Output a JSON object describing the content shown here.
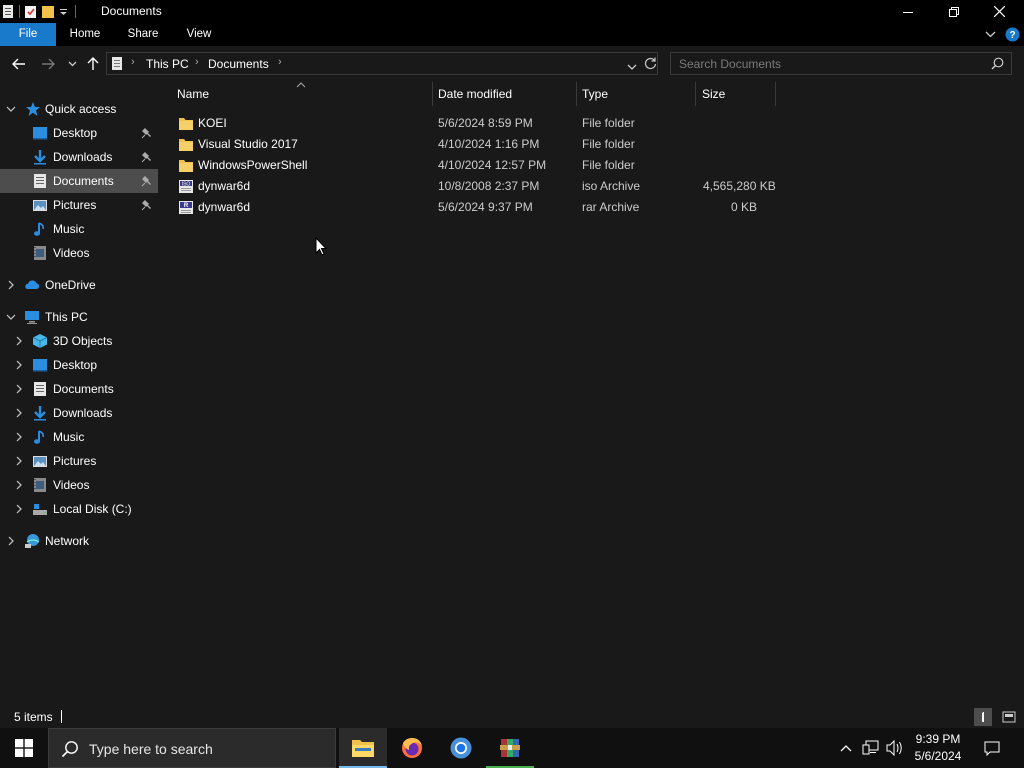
{
  "window": {
    "title": "Documents",
    "icons": [
      "properties-icon",
      "new-folder-icon",
      "folder-icon",
      "customize-dropdown-icon"
    ]
  },
  "ribbon": {
    "tabs": [
      {
        "label": "File"
      },
      {
        "label": "Home"
      },
      {
        "label": "Share"
      },
      {
        "label": "View"
      }
    ]
  },
  "address": {
    "crumbs": [
      "This PC",
      "Documents"
    ]
  },
  "search": {
    "placeholder": "Search Documents"
  },
  "nav": {
    "quick_access": "Quick access",
    "quick_items": [
      {
        "label": "Desktop",
        "icon": "desktop-icon",
        "pinned": true
      },
      {
        "label": "Downloads",
        "icon": "downloads-icon",
        "pinned": true
      },
      {
        "label": "Documents",
        "icon": "documents-icon",
        "pinned": true,
        "selected": true
      },
      {
        "label": "Pictures",
        "icon": "pictures-icon",
        "pinned": true
      },
      {
        "label": "Music",
        "icon": "music-icon",
        "pinned": false
      },
      {
        "label": "Videos",
        "icon": "videos-icon",
        "pinned": false
      }
    ],
    "onedrive": "OneDrive",
    "this_pc": "This PC",
    "pc_items": [
      {
        "label": "3D Objects",
        "icon": "3d-objects-icon"
      },
      {
        "label": "Desktop",
        "icon": "desktop-icon"
      },
      {
        "label": "Documents",
        "icon": "documents-icon"
      },
      {
        "label": "Downloads",
        "icon": "downloads-icon"
      },
      {
        "label": "Music",
        "icon": "music-icon"
      },
      {
        "label": "Pictures",
        "icon": "pictures-icon"
      },
      {
        "label": "Videos",
        "icon": "videos-icon"
      },
      {
        "label": "Local Disk (C:)",
        "icon": "drive-icon"
      }
    ],
    "network": "Network"
  },
  "columns": {
    "name": "Name",
    "date": "Date modified",
    "type": "Type",
    "size": "Size"
  },
  "files": [
    {
      "name": "KOEI",
      "date": "5/6/2024 8:59 PM",
      "type": "File folder",
      "size": "",
      "icon": "folder-icon"
    },
    {
      "name": "Visual Studio 2017",
      "date": "4/10/2024 1:16 PM",
      "type": "File folder",
      "size": "",
      "icon": "folder-icon"
    },
    {
      "name": "WindowsPowerShell",
      "date": "4/10/2024 12:57 PM",
      "type": "File folder",
      "size": "",
      "icon": "folder-icon"
    },
    {
      "name": "dynwar6d",
      "date": "10/8/2008 2:37 PM",
      "type": "iso Archive",
      "size": "4,565,280 KB",
      "icon": "iso-archive-icon"
    },
    {
      "name": "dynwar6d",
      "date": "5/6/2024 9:37 PM",
      "type": "rar Archive",
      "size": "0 KB",
      "icon": "rar-archive-icon"
    }
  ],
  "status": {
    "items": "5 items"
  },
  "taskbar": {
    "search_text": "Type here to search",
    "apps": [
      "file-explorer-icon",
      "firefox-icon",
      "chrome-icon",
      "winrar-icon"
    ],
    "time": "9:39 PM",
    "date": "5/6/2024"
  },
  "colors": {
    "accent": "#1979ca",
    "folder": "#f0c24b",
    "background": "#191919"
  }
}
